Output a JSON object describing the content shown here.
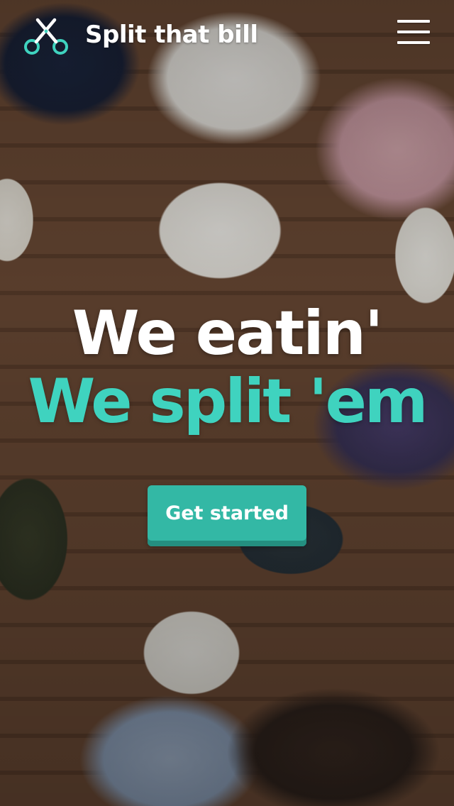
{
  "header": {
    "logo_icon": "scissors-icon",
    "brand_name": "Split that bill",
    "menu_icon": "hamburger-menu-icon"
  },
  "hero": {
    "line1": "We eatin'",
    "line2": "We split 'em",
    "accent_color": "#3fd3bf"
  },
  "cta": {
    "label": "Get started",
    "color": "#33b8a5"
  },
  "background": {
    "description_icon": "photo-background"
  }
}
